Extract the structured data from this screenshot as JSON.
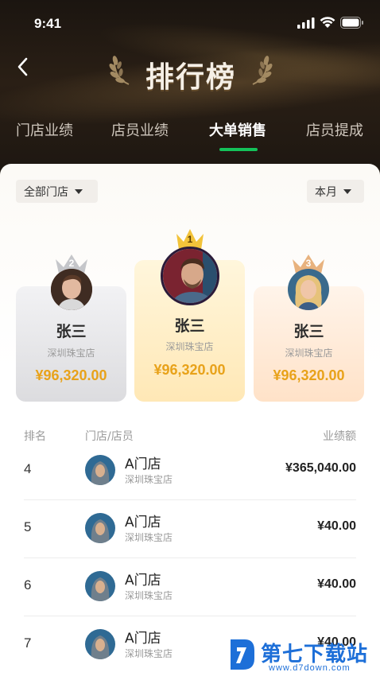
{
  "status_bar": {
    "time": "9:41"
  },
  "header": {
    "title": "排行榜"
  },
  "tabs": [
    {
      "label": "门店业绩",
      "active": false
    },
    {
      "label": "店员业绩",
      "active": false
    },
    {
      "label": "大单销售",
      "active": true
    },
    {
      "label": "店员提成",
      "active": false
    }
  ],
  "filters": {
    "scope": "全部门店",
    "period": "本月"
  },
  "podium": [
    {
      "rank": "2",
      "name": "张三",
      "store": "深圳珠宝店",
      "amount": "¥96,320.00"
    },
    {
      "rank": "1",
      "name": "张三",
      "store": "深圳珠宝店",
      "amount": "¥96,320.00"
    },
    {
      "rank": "3",
      "name": "张三",
      "store": "深圳珠宝店",
      "amount": "¥96,320.00"
    }
  ],
  "list": {
    "headers": {
      "rank": "排名",
      "member": "门店/店员",
      "amount": "业绩额"
    },
    "rows": [
      {
        "rank": "4",
        "name": "A门店",
        "store": "深圳珠宝店",
        "amount": "¥365,040.00"
      },
      {
        "rank": "5",
        "name": "A门店",
        "store": "深圳珠宝店",
        "amount": "¥40.00"
      },
      {
        "rank": "6",
        "name": "A门店",
        "store": "深圳珠宝店",
        "amount": "¥40.00"
      },
      {
        "rank": "7",
        "name": "A门店",
        "store": "深圳珠宝店",
        "amount": "¥40.00"
      }
    ]
  },
  "watermark": {
    "name": "第七下载站",
    "url": "www.d7down.com"
  },
  "colors": {
    "accent": "#14c25a",
    "gold": "#e8a21a",
    "header_bg": "#1b1510"
  }
}
